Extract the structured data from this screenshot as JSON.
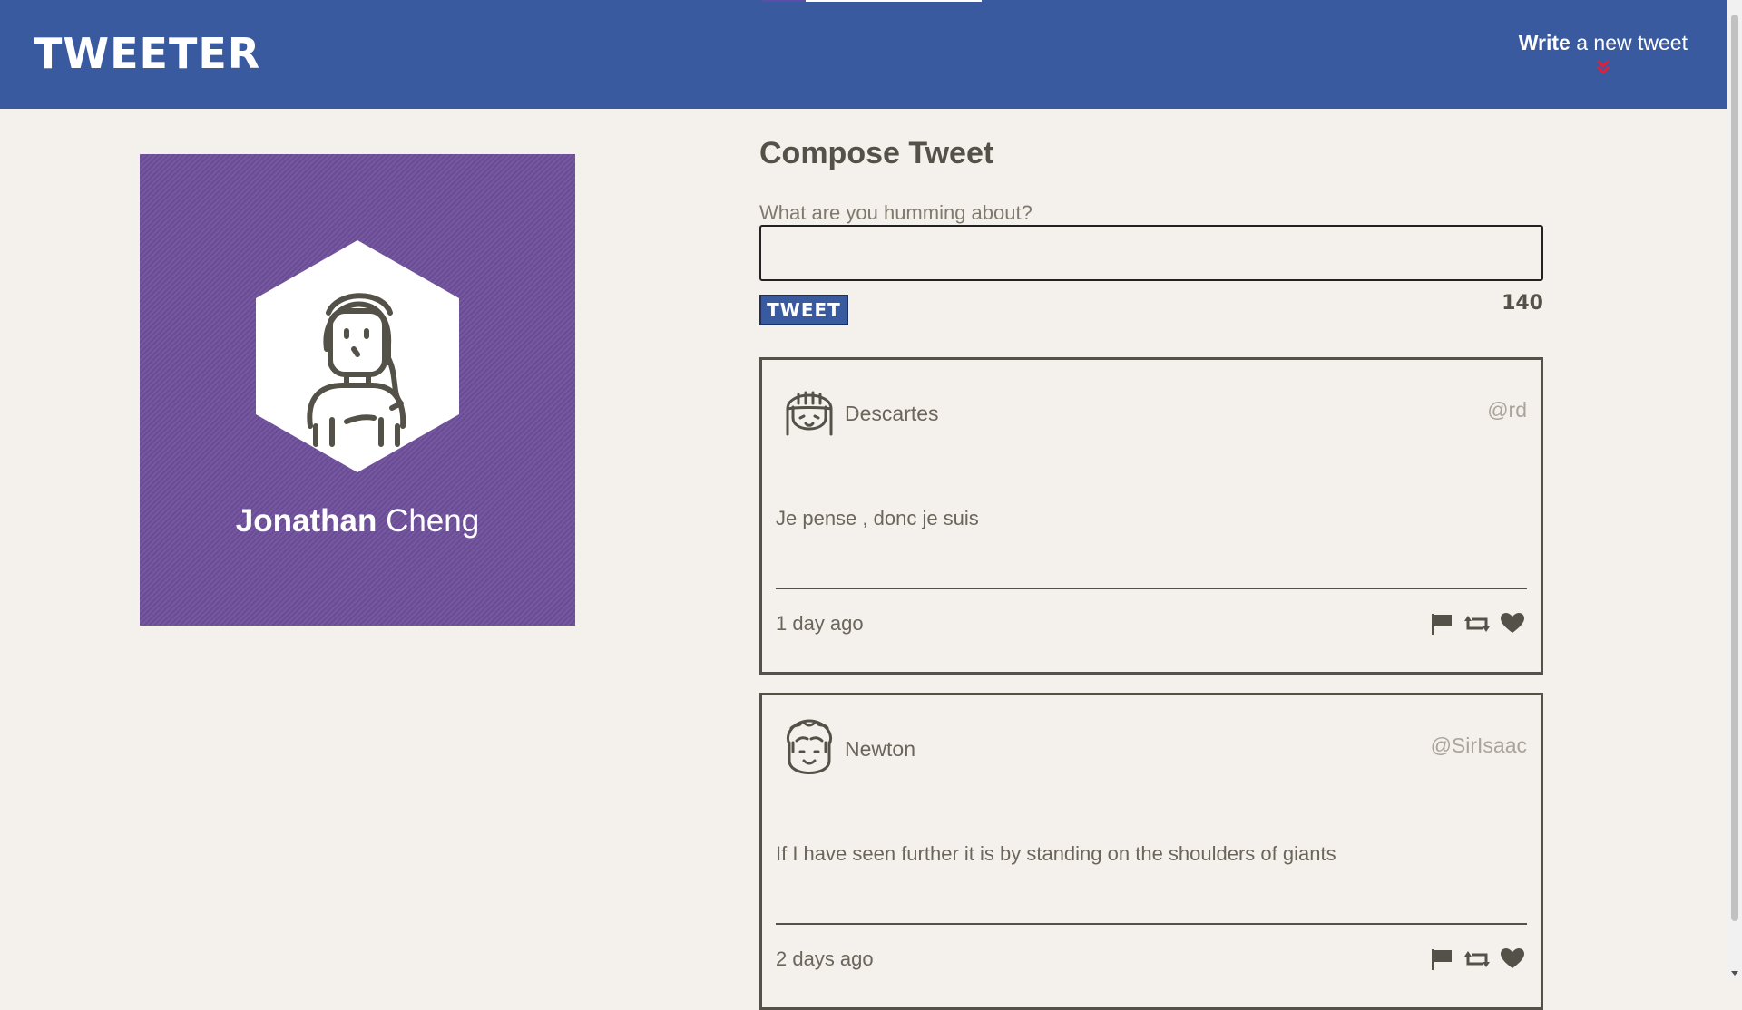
{
  "header": {
    "brand": "TWEETER",
    "compose_toggle": {
      "bold": "Write",
      "rest": " a new tweet"
    },
    "colors": {
      "bar": "#3a5aa0",
      "chevron": "#e0203a"
    }
  },
  "profile": {
    "first_name": "Jonathan",
    "last_name": " Cheng",
    "avatar_icon": "woman-avatar-icon",
    "background": "#6e4f9a"
  },
  "compose": {
    "title": "Compose Tweet",
    "label": "What are you humming about?",
    "value": "",
    "button_label": "TWEET",
    "counter": "140"
  },
  "tweets": [
    {
      "author": "Descartes",
      "handle": "@rd",
      "avatar_icon": "girl-avatar-icon",
      "text": "Je pense , donc je suis",
      "time": "1 day ago"
    },
    {
      "author": "Newton",
      "handle": "@SirIsaac",
      "avatar_icon": "curly-hair-avatar-icon",
      "text": "If I have seen further it is by standing on the shoulders of giants",
      "time": "2 days ago"
    }
  ],
  "action_icons": [
    "flag-icon",
    "retweet-icon",
    "heart-icon"
  ]
}
